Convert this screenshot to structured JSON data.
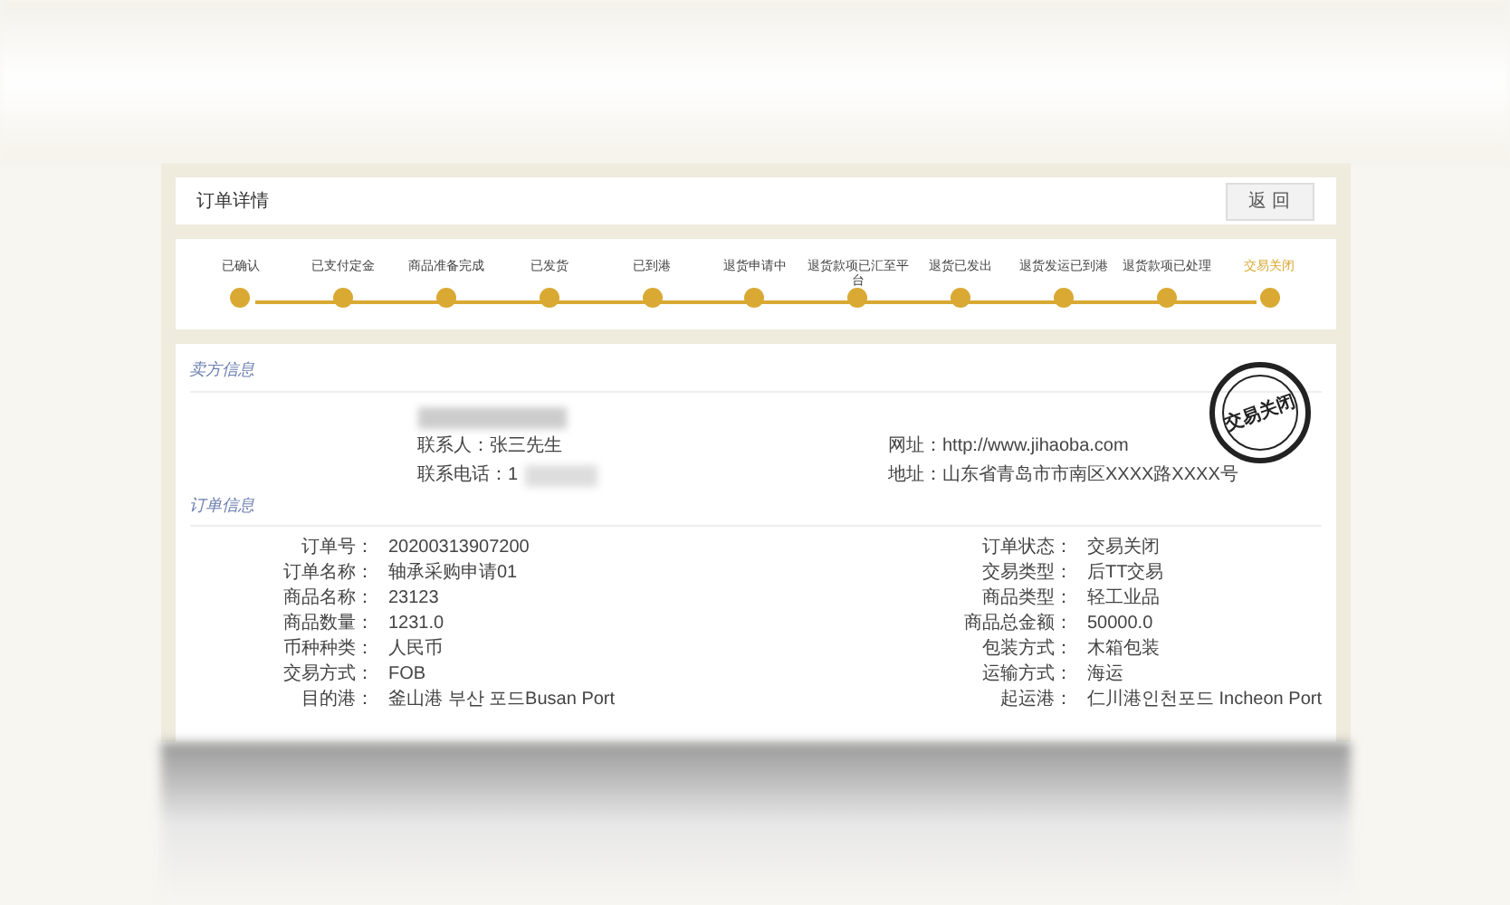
{
  "dialog": {
    "title": "订单详情",
    "back_button": "返 回"
  },
  "steps": [
    {
      "label": "已确认",
      "selected": false
    },
    {
      "label": "已支付定金",
      "selected": false
    },
    {
      "label": "商品准备完成",
      "selected": false
    },
    {
      "label": "已发货",
      "selected": false
    },
    {
      "label": "已到港",
      "selected": false
    },
    {
      "label": "退货申请中",
      "selected": false
    },
    {
      "label": "退货款项已汇至平台",
      "selected": false
    },
    {
      "label": "退货已发出",
      "selected": false
    },
    {
      "label": "退货发运已到港",
      "selected": false
    },
    {
      "label": "退货款项已处理",
      "selected": false
    },
    {
      "label": "交易关闭",
      "selected": true
    }
  ],
  "seller": {
    "heading": "卖方信息",
    "contact": "联系人：张三先生",
    "phone": "联系电话：1",
    "website": "网址：http://www.jihaoba.com",
    "address": "地址：山东省青岛市市南区XXXX路XXXX号",
    "stamp": "交易关闭"
  },
  "order": {
    "heading": "订单信息",
    "fields": [
      {
        "label": "订单号：",
        "value": "20200313907200"
      },
      {
        "label": "订单状态：",
        "value": "交易关闭"
      },
      {
        "label": "订单名称：",
        "value": "轴承采购申请01"
      },
      {
        "label": "交易类型：",
        "value": "后TT交易"
      },
      {
        "label": "商品名称：",
        "value": "23123"
      },
      {
        "label": "商品类型：",
        "value": "轻工业品"
      },
      {
        "label": "商品数量：",
        "value": "1231.0"
      },
      {
        "label": "商品总金额：",
        "value": "50000.0"
      },
      {
        "label": "币种种类：",
        "value": "人民币"
      },
      {
        "label": "包装方式：",
        "value": "木箱包装"
      },
      {
        "label": "交易方式：",
        "value": "FOB"
      },
      {
        "label": "运输方式：",
        "value": "海运"
      },
      {
        "label": "目的港：",
        "value": "釜山港 부산 포드Busan Port"
      },
      {
        "label": "起运港：",
        "value": "仁川港인천포드 Incheon Port"
      }
    ]
  }
}
